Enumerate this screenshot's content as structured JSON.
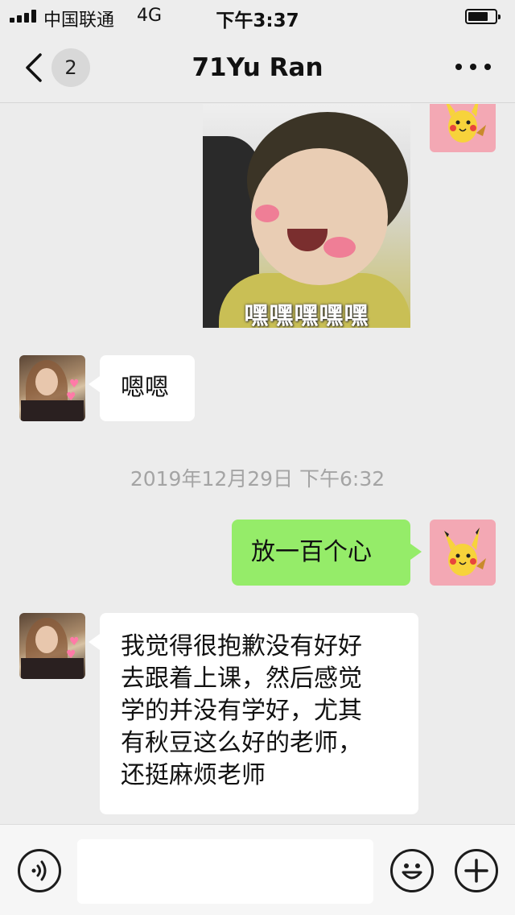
{
  "status_bar": {
    "carrier": "中国联通",
    "network": "4G",
    "time": "下午3:37"
  },
  "nav": {
    "unread_count": "2",
    "title": "71Yu Ran"
  },
  "messages": {
    "sticker_caption": "嘿嘿嘿嘿嘿",
    "friend_msg_1": "嗯嗯",
    "timestamp": "2019年12月29日 下午6:32",
    "self_msg_1": "放一百个心",
    "friend_msg_2_lines": [
      "我觉得很抱歉没有好好",
      "去跟着上课，然后感觉",
      "学的并没有学好，尤其",
      "有秋豆这么好的老师，",
      "还挺麻烦老师"
    ]
  },
  "input_bar": {
    "text_value": ""
  },
  "colors": {
    "outgoing_bubble": "#95ec69",
    "incoming_bubble": "#ffffff",
    "background": "#ececec",
    "self_avatar_bg": "#f3a8b4"
  },
  "icons": [
    "signal-icon",
    "battery-icon",
    "back-chevron-icon",
    "more-dots-icon",
    "voice-icon",
    "emoji-icon",
    "plus-icon"
  ]
}
